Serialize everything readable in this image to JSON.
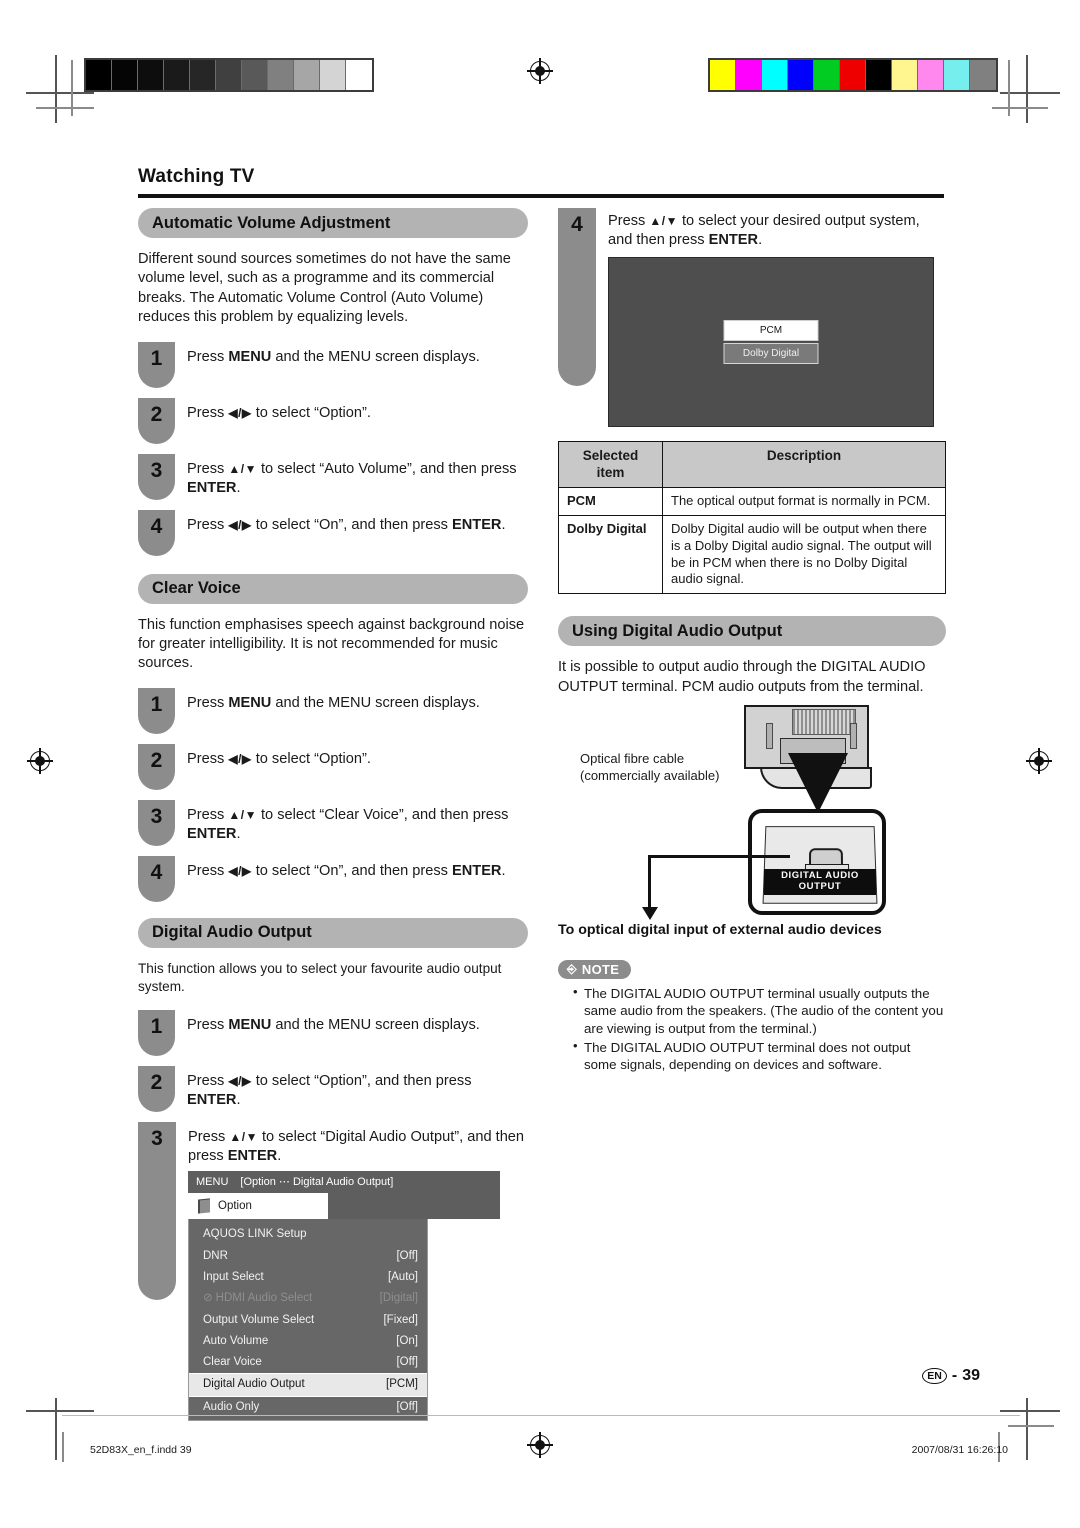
{
  "document": {
    "running_head": "Watching TV",
    "page_number": "39",
    "page_locale_badge": "EN",
    "footer_file": "52D83X_en_f.indd   39",
    "footer_timestamp": "2007/08/31   16:26:10"
  },
  "print_marks": {
    "grayscale_bar": [
      "#000000",
      "#050505",
      "#0d0d0d",
      "#1a1a1a",
      "#262626",
      "#404040",
      "#595959",
      "#808080",
      "#a6a6a6",
      "#d4d4d4",
      "#ffffff"
    ],
    "color_bar": [
      "#ffff00",
      "#ff00ff",
      "#00ffff",
      "#0000ff",
      "#00cc22",
      "#ee0000",
      "#000000",
      "#fff municipal",
      "#ff88ee",
      "#77eeee",
      "#808080"
    ],
    "color_bar_fixed": [
      "#ffff00",
      "#ff00ff",
      "#00ffff",
      "#0000ff",
      "#00cc22",
      "#ee0000",
      "#000000",
      "#fff68f",
      "#ff88ee",
      "#77eeee",
      "#808080"
    ]
  },
  "left_column": {
    "section1": {
      "title": "Automatic Volume Adjustment",
      "intro": "Different sound sources sometimes do not have the same volume level, such as a programme and its commercial breaks. The Automatic Volume Control (Auto Volume) reduces this problem by equalizing levels.",
      "steps": [
        {
          "num": "1",
          "before": "Press ",
          "bold1": "MENU",
          "after": " and the MENU screen displays."
        },
        {
          "num": "2",
          "before": "Press ",
          "arrows": "◀/▶",
          "after": " to select “Option”."
        },
        {
          "num": "3",
          "before": "Press ",
          "arrows": "▲/▼",
          "after": " to select “Auto Volume”, and then press ",
          "bold2": "ENTER",
          "tail": "."
        },
        {
          "num": "4",
          "before": "Press ",
          "arrows": "◀/▶",
          "after": " to select “On”, and then press ",
          "bold2": "ENTER",
          "tail": "."
        }
      ]
    },
    "section2": {
      "title": "Clear Voice",
      "intro": "This function emphasises speech against background noise for greater intelligibility. It is not recommended for music sources.",
      "steps": [
        {
          "num": "1",
          "before": "Press ",
          "bold1": "MENU",
          "after": " and the MENU screen displays."
        },
        {
          "num": "2",
          "before": "Press ",
          "arrows": "◀/▶",
          "after": " to select “Option”."
        },
        {
          "num": "3",
          "before": "Press ",
          "arrows": "▲/▼",
          "after": " to select “Clear Voice”, and then press ",
          "bold2": "ENTER",
          "tail": "."
        },
        {
          "num": "4",
          "before": "Press ",
          "arrows": "◀/▶",
          "after": " to select “On”, and then press ",
          "bold2": "ENTER",
          "tail": "."
        }
      ]
    },
    "section3": {
      "title": "Digital Audio Output",
      "intro": "This function allows you to select your favourite audio output system.",
      "steps": [
        {
          "num": "1",
          "before": "Press ",
          "bold1": "MENU",
          "after": " and the MENU screen displays."
        },
        {
          "num": "2",
          "before": "Press ",
          "arrows": "◀/▶",
          "after": " to select “Option”, and then press ",
          "bold2": "ENTER",
          "tail": "."
        },
        {
          "num": "3",
          "before": "Press ",
          "arrows": "▲/▼",
          "after": " to select “Digital Audio Output”, and then press ",
          "bold2": "ENTER",
          "tail": "."
        }
      ]
    },
    "osd_menu": {
      "titlebar_label": "MENU",
      "titlebar_path": "[Option ⋯ Digital Audio Output]",
      "tab_label": "Option",
      "rows": [
        {
          "label": "AQUOS LINK Setup",
          "value": "",
          "state": "normal"
        },
        {
          "label": "DNR",
          "value": "[Off]",
          "state": "normal"
        },
        {
          "label": "Input Select",
          "value": "[Auto]",
          "state": "normal"
        },
        {
          "label": "HDMI Audio Select",
          "value": "[Digital]",
          "state": "disabled",
          "prefix_icon": "prohibit-icon"
        },
        {
          "label": "Output Volume Select",
          "value": "[Fixed]",
          "state": "normal"
        },
        {
          "label": "Auto Volume",
          "value": "[On]",
          "state": "normal"
        },
        {
          "label": "Clear Voice",
          "value": "[Off]",
          "state": "normal"
        },
        {
          "label": "Digital Audio Output",
          "value": "[PCM]",
          "state": "selected"
        },
        {
          "label": "Audio Only",
          "value": "[Off]",
          "state": "normal"
        }
      ]
    }
  },
  "right_column": {
    "step4": {
      "num": "4",
      "before": "Press ",
      "arrows": "▲/▼",
      "after": " to select your desired output system, and then press ",
      "bold2": "ENTER",
      "tail": "."
    },
    "tv_screen": {
      "option_selected": "PCM",
      "option_other": "Dolby Digital"
    },
    "description_table": {
      "headers": [
        "Selected item",
        "Description"
      ],
      "rows": [
        {
          "item": "PCM",
          "description": "The optical output format is normally in PCM."
        },
        {
          "item": "Dolby Digital",
          "description": "Dolby Digital audio will be output when there is a Dolby Digital audio signal. The output will be in PCM when there is no Dolby Digital audio signal."
        }
      ]
    },
    "section_using": {
      "title": "Using Digital Audio Output",
      "intro": "It is possible to output audio through the DIGITAL AUDIO OUTPUT terminal. PCM audio outputs from the terminal."
    },
    "illustration": {
      "cable_caption_line1": "Optical fibre cable",
      "cable_caption_line2": "(commercially available)",
      "terminal_label_line1": "DIGITAL AUDIO",
      "terminal_label_line2": "OUTPUT",
      "footer_caption": "To optical digital input of external audio devices"
    },
    "note": {
      "tag": "NOTE",
      "items": [
        "The DIGITAL AUDIO OUTPUT terminal usually outputs the same audio from the speakers. (The audio of the content you are viewing is output from the terminal.)",
        "The DIGITAL AUDIO OUTPUT terminal does not output some signals, depending on devices and software."
      ]
    }
  }
}
